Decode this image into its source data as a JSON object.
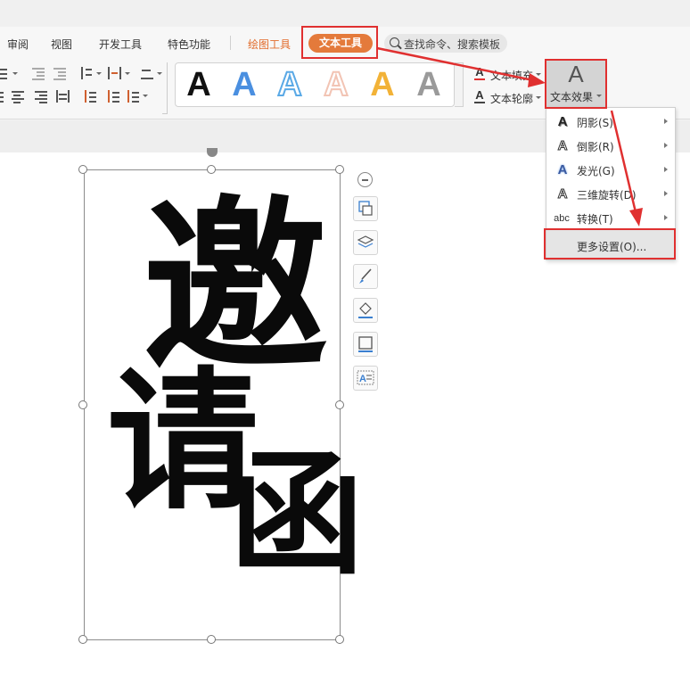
{
  "ribbon": {
    "tabs": [
      {
        "label": "审阅"
      },
      {
        "label": "视图"
      },
      {
        "label": "开发工具"
      },
      {
        "label": "特色功能"
      },
      {
        "label": "绘图工具"
      },
      {
        "label": "文本工具"
      }
    ],
    "search": {
      "text": "查找命令、搜索模板"
    }
  },
  "gallery": {
    "styles": [
      {
        "glyph": "A",
        "color": "#111111"
      },
      {
        "glyph": "A",
        "color": "#4a8fe0"
      },
      {
        "glyph": "A",
        "color": "#5aa9e6"
      },
      {
        "glyph": "A",
        "color": "#f2c4b4"
      },
      {
        "glyph": "A",
        "color": "#f2b237"
      },
      {
        "glyph": "A",
        "color": "#9a9a9a"
      }
    ]
  },
  "text_fill": {
    "label": "文本填充"
  },
  "text_outline": {
    "label": "文本轮廓"
  },
  "text_effect": {
    "label": "文本效果"
  },
  "effect_menu": {
    "items": [
      {
        "label": "阴影(S)"
      },
      {
        "label": "倒影(R)"
      },
      {
        "label": "发光(G)"
      },
      {
        "label": "三维旋转(D)"
      },
      {
        "label": "转换(T)"
      }
    ],
    "more": "更多设置(O)..."
  },
  "canvas": {
    "characters": [
      "邀",
      "请",
      "函"
    ]
  },
  "colors": {
    "accent_orange": "#e47a3b",
    "annotation_red": "#e03030"
  }
}
